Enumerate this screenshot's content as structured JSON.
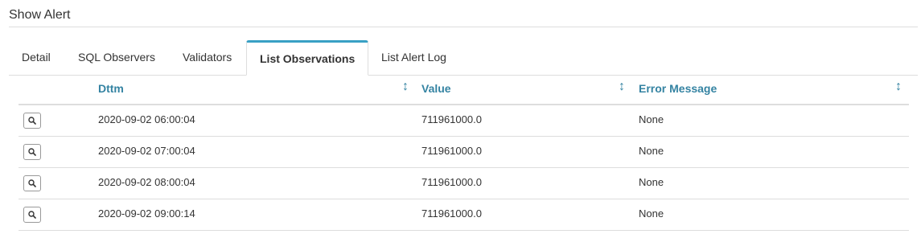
{
  "page": {
    "title": "Show Alert"
  },
  "tabs": [
    {
      "label": "Detail",
      "active": false
    },
    {
      "label": "SQL Observers",
      "active": false
    },
    {
      "label": "Validators",
      "active": false
    },
    {
      "label": "List Observations",
      "active": true
    },
    {
      "label": "List Alert Log",
      "active": false
    }
  ],
  "table": {
    "headers": {
      "dttm": "Dttm",
      "value": "Value",
      "error": "Error Message"
    },
    "sort_icon": "↕",
    "view_icon": "search-icon",
    "rows": [
      {
        "dttm": "2020-09-02 06:00:04",
        "value": "711961000.0",
        "error": "None"
      },
      {
        "dttm": "2020-09-02 07:00:04",
        "value": "711961000.0",
        "error": "None"
      },
      {
        "dttm": "2020-09-02 08:00:04",
        "value": "711961000.0",
        "error": "None"
      },
      {
        "dttm": "2020-09-02 09:00:14",
        "value": "711961000.0",
        "error": "None"
      }
    ]
  },
  "colors": {
    "accent": "#39a0c4",
    "header_text": "#3483a2",
    "border": "#dddddd"
  }
}
